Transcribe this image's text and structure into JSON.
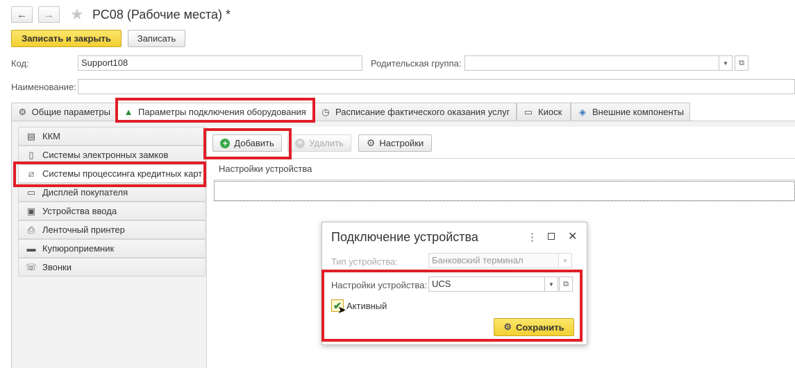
{
  "window": {
    "title": "РС08 (Рабочие места) *"
  },
  "toolbar": {
    "save_close_label": "Записать и закрыть",
    "save_label": "Записать"
  },
  "fields": {
    "code_label": "Код:",
    "code_value": "Support108",
    "parent_label": "Родительская группа:",
    "parent_value": "",
    "name_label": "Наименование:",
    "name_value": ""
  },
  "tabs": [
    {
      "label": "Общие параметры",
      "icon": "gear-icon"
    },
    {
      "label": "Параметры подключения оборудования",
      "icon": "equipment-icon"
    },
    {
      "label": "Расписание фактического оказания услуг",
      "icon": "clock-icon"
    },
    {
      "label": "Киоск",
      "icon": "kiosk-icon"
    },
    {
      "label": "Внешние компоненты",
      "icon": "component-icon"
    }
  ],
  "sidebar": {
    "items": [
      {
        "label": "ККМ",
        "icon": "cash-register-icon"
      },
      {
        "label": "Системы электронных замков",
        "icon": "lock-icon"
      },
      {
        "label": "Системы процессинга кредитных карт",
        "icon": "card-icon"
      },
      {
        "label": "Дисплей покупателя",
        "icon": "display-icon"
      },
      {
        "label": "Устройства ввода",
        "icon": "input-device-icon"
      },
      {
        "label": "Ленточный принтер",
        "icon": "printer-icon"
      },
      {
        "label": "Купюроприемник",
        "icon": "bill-acceptor-icon"
      },
      {
        "label": "Звонки",
        "icon": "phone-icon"
      }
    ]
  },
  "content": {
    "add_label": "Добавить",
    "delete_label": "Удалить",
    "settings_label": "Настройки",
    "column_header": "Настройки устройства"
  },
  "dialog": {
    "title": "Подключение устройства",
    "device_type_label": "Тип устройства:",
    "device_type_value": "Банковский терминал",
    "device_settings_label": "Настройки устройства:",
    "device_settings_value": "UCS",
    "active_label": "Активный",
    "active_checked": true,
    "save_label": "Сохранить"
  },
  "colors": {
    "highlight_red": "#e01e28",
    "primary_yellow": "#f3d032"
  }
}
